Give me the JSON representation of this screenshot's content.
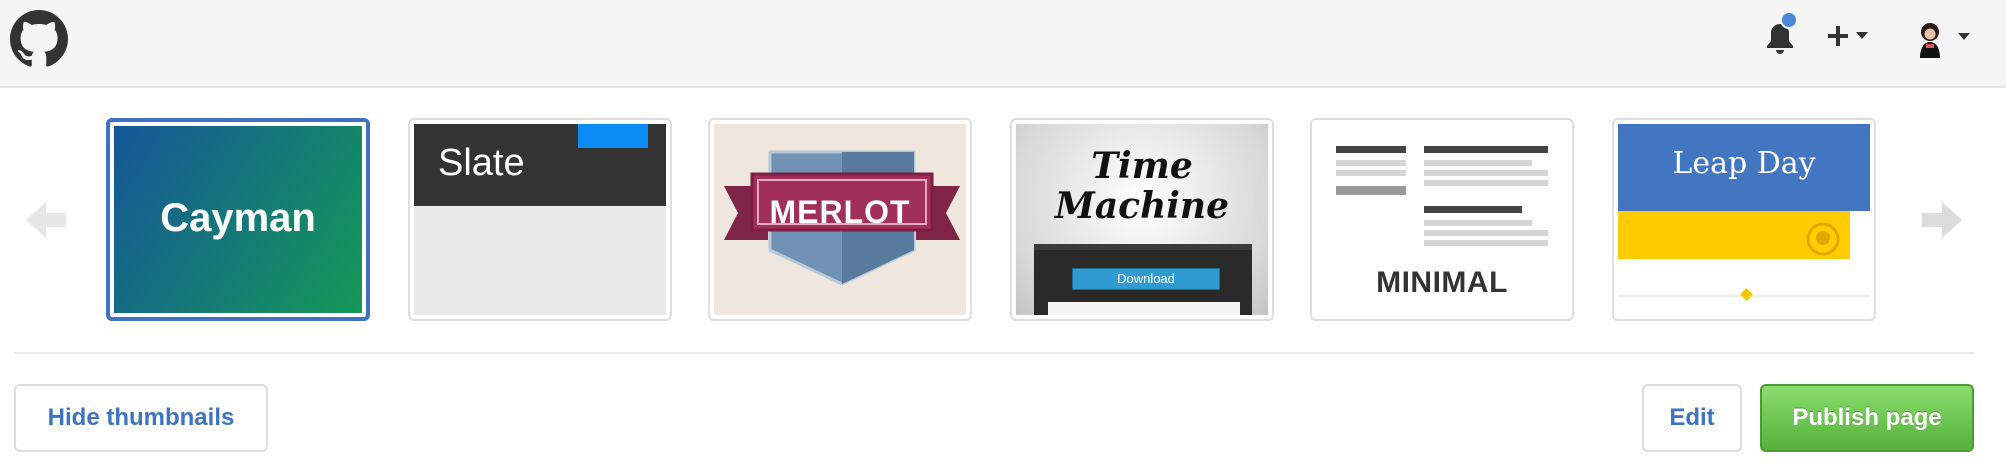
{
  "header": {
    "logo_icon": "github-octocat-icon",
    "notifications_icon": "bell-icon",
    "create_icon": "plus-dropdown-icon",
    "avatar_icon": "user-avatar-icon"
  },
  "themes": [
    {
      "name": "Cayman",
      "selected": true
    },
    {
      "name": "Slate",
      "selected": false
    },
    {
      "name": "MERLOT",
      "selected": false
    },
    {
      "name": "Time Machine",
      "line1": "Time",
      "line2": "Machine",
      "button": "Download",
      "selected": false
    },
    {
      "name": "MINIMAL",
      "selected": false
    },
    {
      "name": "Leap Day",
      "selected": false
    }
  ],
  "nav": {
    "prev_icon": "arrow-left-icon",
    "next_icon": "arrow-right-icon"
  },
  "actions": {
    "hide_thumbnails": "Hide thumbnails",
    "edit": "Edit",
    "publish": "Publish page"
  },
  "colors": {
    "header_bg": "#f5f5f5",
    "selected_border": "#3f72c1",
    "link_blue": "#3d74c4",
    "publish_green": "#56b13b",
    "notification_dot": "#4a87d6"
  }
}
